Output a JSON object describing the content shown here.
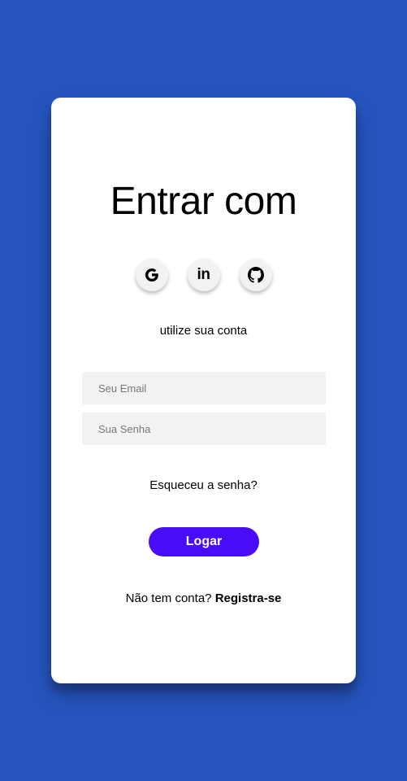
{
  "colors": {
    "background": "#2655bf",
    "card": "#ffffff",
    "field_bg": "#f2f2f2",
    "button": "#4a0cf7"
  },
  "login": {
    "title": "Entrar com",
    "socials": [
      {
        "name": "google",
        "icon": "google-icon",
        "glyph": "G"
      },
      {
        "name": "linkedin",
        "icon": "linkedin-icon",
        "glyph": "in"
      },
      {
        "name": "github",
        "icon": "github-icon"
      }
    ],
    "subtitle": "utilize sua conta",
    "email_placeholder": "Seu Email",
    "password_placeholder": "Sua Senha",
    "forgot_password": "Esqueceu a senha?",
    "submit_label": "Logar",
    "no_account_text": "Não tem conta?",
    "signup_link": "Registra-se"
  }
}
